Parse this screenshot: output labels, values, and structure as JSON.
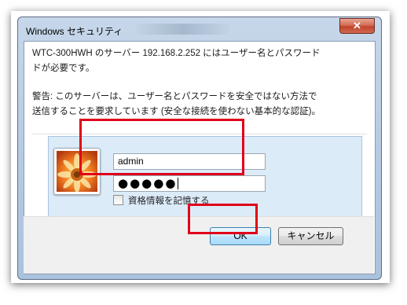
{
  "window": {
    "title": "Windows セキュリティ",
    "close_glyph": "✕"
  },
  "message": {
    "line1": "WTC-300HWH のサーバー 192.168.2.252 にはユーザー名とパスワード\nドが必要です。",
    "warning": "警告: このサーバーは、ユーザー名とパスワードを安全ではない方法で\n送信することを要求しています (安全な接続を使わない基本的な認証)。"
  },
  "credentials": {
    "username": "admin",
    "password_mask": "●●●●●",
    "remember_label": "資格情報を記憶する"
  },
  "buttons": {
    "ok": "OK",
    "cancel": "キャンセル"
  },
  "icons": {
    "user_tile": "flower-user-icon",
    "close": "close-icon"
  },
  "colors": {
    "highlight": "#e0001a"
  }
}
